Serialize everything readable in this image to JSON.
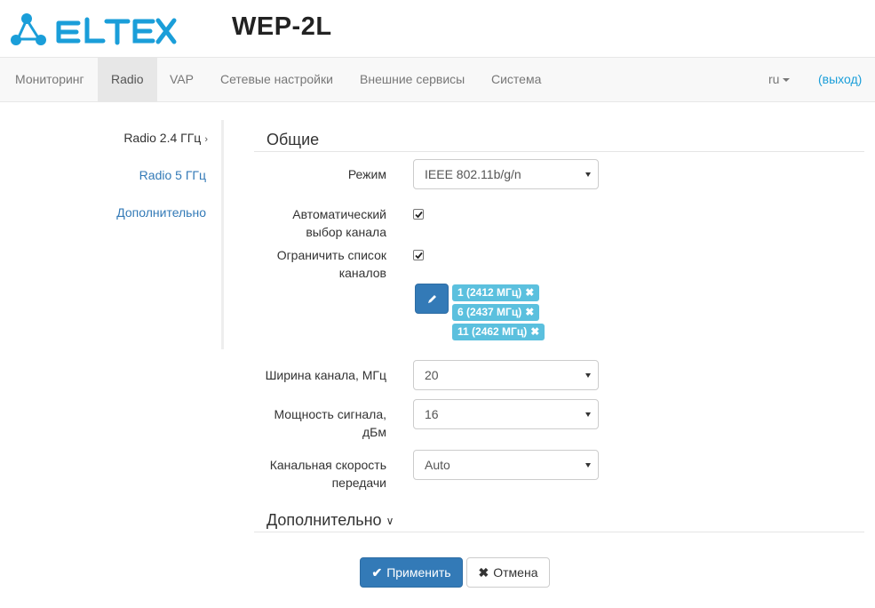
{
  "header": {
    "brand": "ELTEX",
    "device": "WEP-2L",
    "brand_color": "#1a9ed9"
  },
  "navbar": {
    "items": [
      {
        "label": "Мониторинг",
        "active": false
      },
      {
        "label": "Radio",
        "active": true
      },
      {
        "label": "VAP",
        "active": false
      },
      {
        "label": "Сетевые настройки",
        "active": false
      },
      {
        "label": "Внешние сервисы",
        "active": false
      },
      {
        "label": "Система",
        "active": false
      }
    ],
    "language": "ru",
    "logout": "(выход)"
  },
  "sidebar": {
    "items": [
      {
        "label": "Radio 2.4 ГГц",
        "active": true
      },
      {
        "label": "Radio 5 ГГц",
        "active": false
      },
      {
        "label": "Дополнительно",
        "active": false
      }
    ]
  },
  "general": {
    "title": "Общие",
    "mode_label": "Режим",
    "mode_value": "IEEE 802.11b/g/n",
    "auto_channel_label_1": "Автоматический",
    "auto_channel_label_2": "выбор канала",
    "auto_channel_checked": true,
    "limit_channels_label_1": "Ограничить список",
    "limit_channels_label_2": "каналов",
    "limit_channels_checked": true,
    "edit_icon": "pencil-icon",
    "channels": [
      "1 (2412 МГц)",
      "6 (2437 МГц)",
      "11 (2462 МГц)"
    ],
    "width_label": "Ширина канала, МГц",
    "width_value": "20",
    "power_label_1": "Мощность сигнала,",
    "power_label_2": "дБм",
    "power_value": "16",
    "rate_label_1": "Канальная скорость",
    "rate_label_2": "передачи",
    "rate_value": "Auto"
  },
  "advanced": {
    "title": "Дополнительно"
  },
  "actions": {
    "apply": "Применить",
    "cancel": "Отмена",
    "apply_icon": "check-icon",
    "cancel_icon": "times-icon"
  }
}
